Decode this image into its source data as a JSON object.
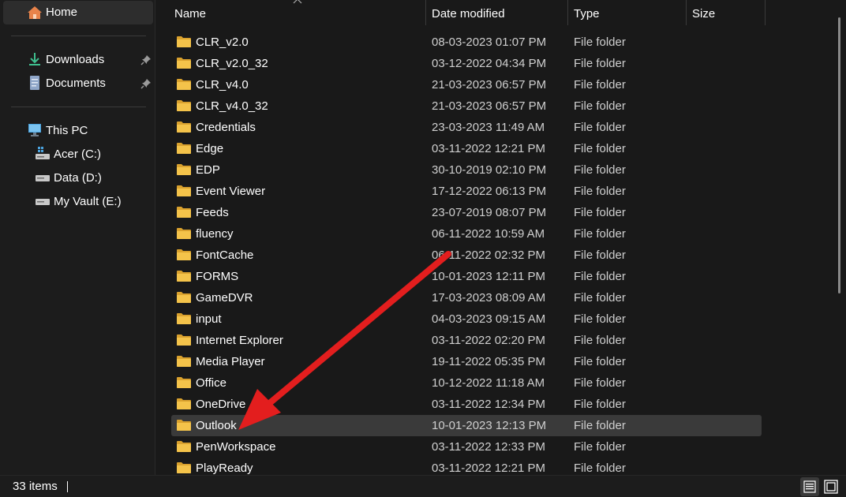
{
  "sidebar": {
    "home": "Home",
    "quick_access": [
      {
        "label": "Downloads",
        "icon": "download-icon",
        "pinned": true
      },
      {
        "label": "Documents",
        "icon": "document-icon",
        "pinned": true
      }
    ],
    "this_pc": "This PC",
    "drives": [
      {
        "label": "Acer (C:)",
        "icon": "windows-drive-icon"
      },
      {
        "label": "Data (D:)",
        "icon": "drive-icon"
      },
      {
        "label": "My Vault (E:)",
        "icon": "drive-icon"
      }
    ]
  },
  "columns": {
    "name": "Name",
    "date": "Date modified",
    "type": "Type",
    "size": "Size"
  },
  "files": [
    {
      "name": "CLR_v2.0",
      "date": "08-03-2023 01:07 PM",
      "type": "File folder"
    },
    {
      "name": "CLR_v2.0_32",
      "date": "03-12-2022 04:34 PM",
      "type": "File folder"
    },
    {
      "name": "CLR_v4.0",
      "date": "21-03-2023 06:57 PM",
      "type": "File folder"
    },
    {
      "name": "CLR_v4.0_32",
      "date": "21-03-2023 06:57 PM",
      "type": "File folder"
    },
    {
      "name": "Credentials",
      "date": "23-03-2023 11:49 AM",
      "type": "File folder"
    },
    {
      "name": "Edge",
      "date": "03-11-2022 12:21 PM",
      "type": "File folder"
    },
    {
      "name": "EDP",
      "date": "30-10-2019 02:10 PM",
      "type": "File folder"
    },
    {
      "name": "Event Viewer",
      "date": "17-12-2022 06:13 PM",
      "type": "File folder"
    },
    {
      "name": "Feeds",
      "date": "23-07-2019 08:07 PM",
      "type": "File folder"
    },
    {
      "name": "fluency",
      "date": "06-11-2022 10:59 AM",
      "type": "File folder"
    },
    {
      "name": "FontCache",
      "date": "06-11-2022 02:32 PM",
      "type": "File folder"
    },
    {
      "name": "FORMS",
      "date": "10-01-2023 12:11 PM",
      "type": "File folder"
    },
    {
      "name": "GameDVR",
      "date": "17-03-2023 08:09 AM",
      "type": "File folder"
    },
    {
      "name": "input",
      "date": "04-03-2023 09:15 AM",
      "type": "File folder"
    },
    {
      "name": "Internet Explorer",
      "date": "03-11-2022 02:20 PM",
      "type": "File folder"
    },
    {
      "name": "Media Player",
      "date": "19-11-2022 05:35 PM",
      "type": "File folder"
    },
    {
      "name": "Office",
      "date": "10-12-2022 11:18 AM",
      "type": "File folder"
    },
    {
      "name": "OneDrive",
      "date": "03-11-2022 12:34 PM",
      "type": "File folder"
    },
    {
      "name": "Outlook",
      "date": "10-01-2023 12:13 PM",
      "type": "File folder",
      "selected": true
    },
    {
      "name": "PenWorkspace",
      "date": "03-11-2022 12:33 PM",
      "type": "File folder"
    },
    {
      "name": "PlayReady",
      "date": "03-11-2022 12:21 PM",
      "type": "File folder"
    }
  ],
  "status": {
    "item_count": "33 items"
  },
  "colors": {
    "folder": "#f4c34a",
    "folder_dark": "#d9a12e",
    "arrow": "#e31e1e",
    "selected_row": "#3a3a3a"
  }
}
